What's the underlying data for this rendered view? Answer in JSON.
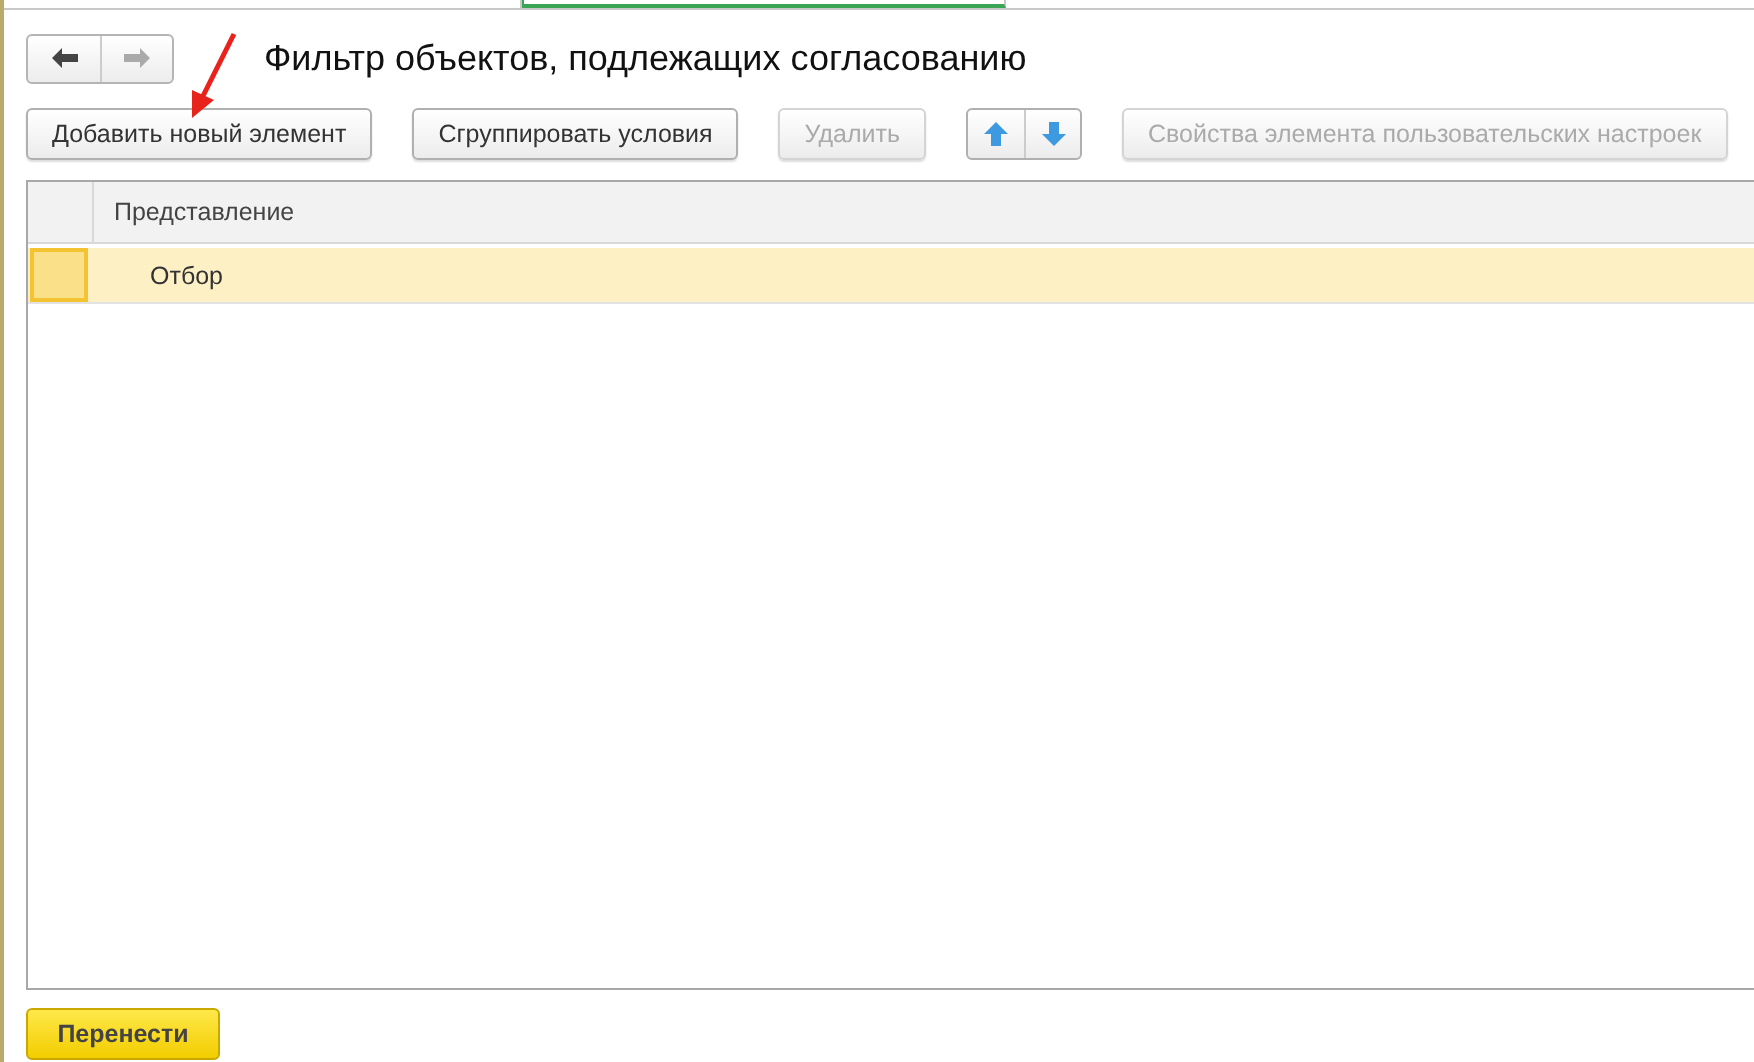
{
  "title": "Фильтр объектов, подлежащих согласованию",
  "nav": [
    {
      "kind": "back",
      "disabled": false
    },
    {
      "kind": "forward",
      "disabled": true
    }
  ],
  "toolbar": [
    {
      "kind": "button",
      "label": "Добавить новый элемент",
      "disabled": false
    },
    {
      "kind": "button",
      "label": "Сгруппировать условия",
      "disabled": false
    },
    {
      "kind": "button",
      "label": "Удалить",
      "disabled": true
    },
    {
      "kind": "arrows"
    },
    {
      "kind": "button",
      "label": "Свойства элемента пользовательских настроек",
      "disabled": true
    }
  ],
  "table": {
    "columns": [
      "Представление"
    ],
    "rows": [
      {
        "cells": [
          "Отбор"
        ],
        "selected": true
      }
    ]
  },
  "footer_button": "Перенести"
}
